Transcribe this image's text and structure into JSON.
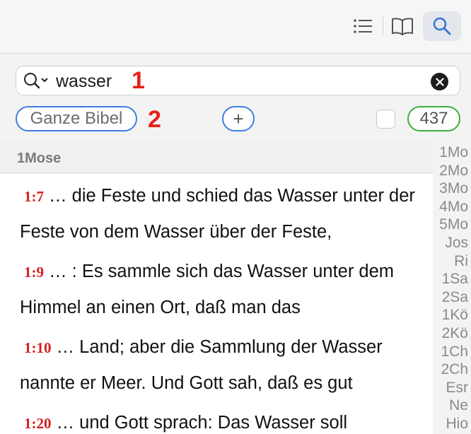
{
  "toolbar": {
    "icons": [
      "list-icon",
      "book-icon",
      "search-icon"
    ]
  },
  "search": {
    "query": "wasser",
    "marker_1": "1",
    "marker_2": "2"
  },
  "filters": {
    "range_label": "Ganze Bibel",
    "add_label": "+",
    "result_count": "437"
  },
  "section": {
    "book": "1Mose"
  },
  "results": [
    {
      "ref": "1:7",
      "text": " … die Feste und schied das Wasser unter der Feste von dem  Wasser über der Feste,"
    },
    {
      "ref": "1:9",
      "text": " … : Es sammle sich das Wasser unter dem Himmel an einen Ort,  daß man das"
    },
    {
      "ref": "1:10",
      "text": " … Land; aber die Sammlung der Wasser nannte  er Meer. Und Gott sah, daß es gut"
    },
    {
      "ref": "1:20",
      "text": " … und Gott sprach: Das Wasser soll"
    }
  ],
  "book_index": [
    "1Mo",
    "2Mo",
    "3Mo",
    "4Mo",
    "5Mo",
    "Jos",
    "Ri",
    "1Sa",
    "2Sa",
    "1Kö",
    "2Kö",
    "1Ch",
    "2Ch",
    "Esr",
    "Ne",
    "Hio"
  ],
  "colors": {
    "accent_blue": "#3d7ede",
    "count_green": "#3fae3a",
    "verse_ref_red": "#d61f1f",
    "marker_red": "#e8201b"
  }
}
